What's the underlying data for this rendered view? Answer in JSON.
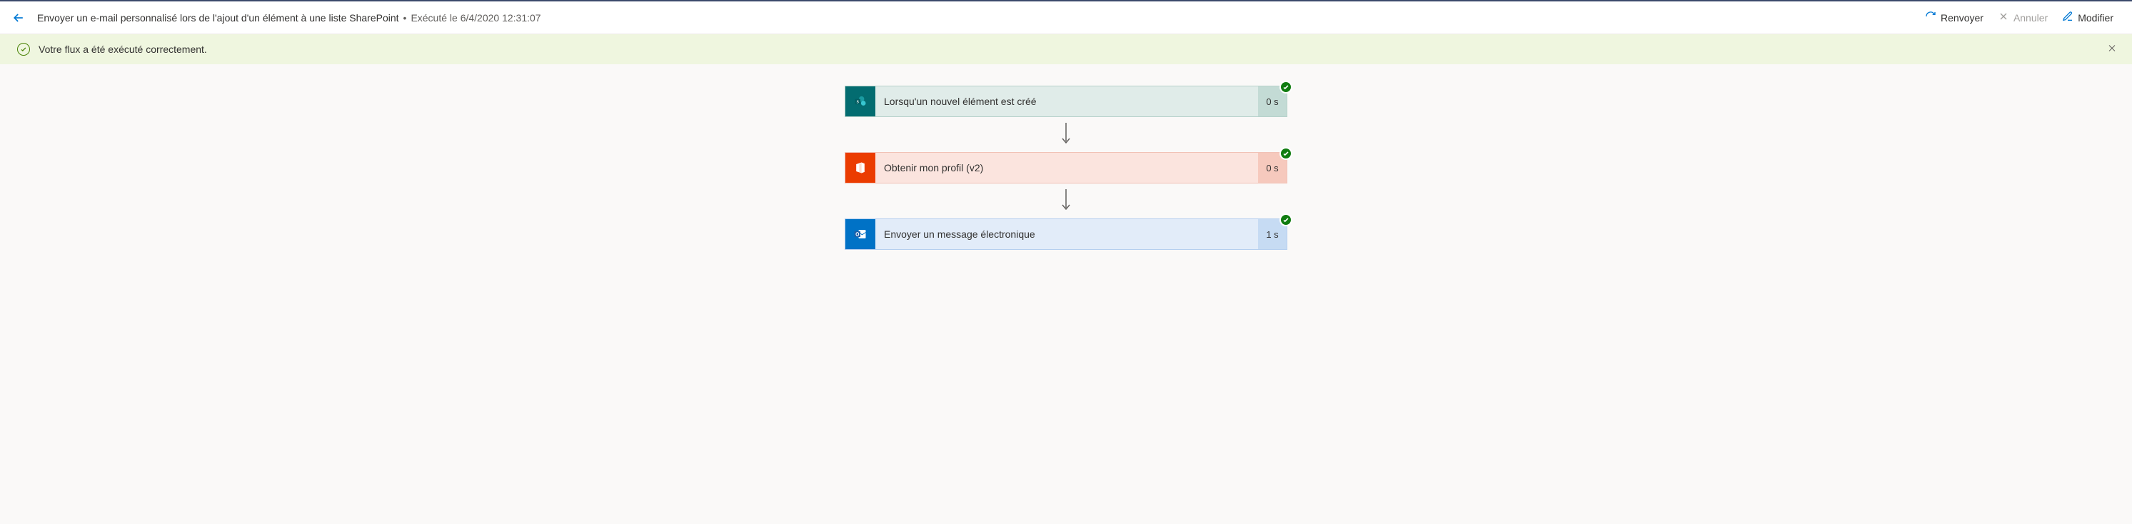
{
  "header": {
    "title": "Envoyer un e-mail personnalisé lors de l'ajout d'un élément à une liste SharePoint",
    "separator": "•",
    "executed_label": "Exécuté le 6/4/2020 12:31:07",
    "actions": {
      "resend": "Renvoyer",
      "cancel": "Annuler",
      "edit": "Modifier"
    }
  },
  "banner": {
    "message": "Votre flux a été exécuté correctement."
  },
  "steps": [
    {
      "label": "Lorsqu'un nouvel élément est créé",
      "duration": "0 s"
    },
    {
      "label": "Obtenir mon profil (v2)",
      "duration": "0 s"
    },
    {
      "label": "Envoyer un message électronique",
      "duration": "1 s"
    }
  ]
}
